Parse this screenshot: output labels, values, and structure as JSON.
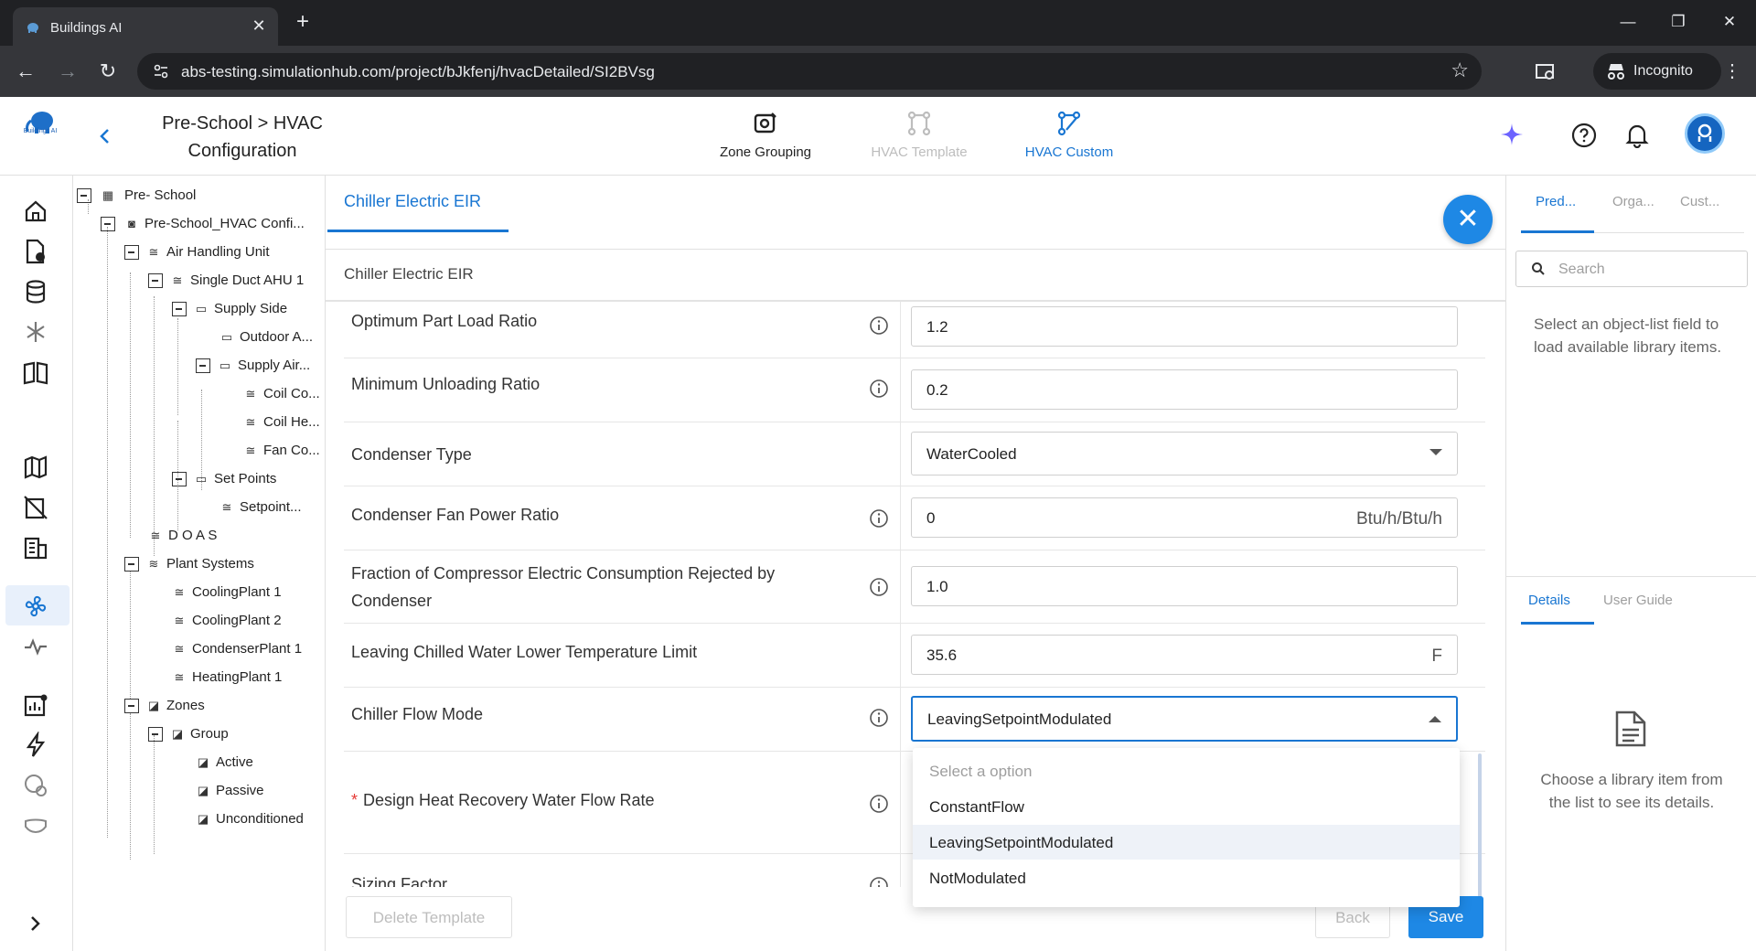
{
  "browser": {
    "tab_title": "Buildings AI",
    "url": "abs-testing.simulationhub.com/project/bJkfenj/hvacDetailed/SI2BVsg",
    "incognito_label": "Incognito"
  },
  "header": {
    "logo_text": "Buildings AI",
    "project_title": "Pre-School > HVAC Configuration",
    "tabs": [
      {
        "label": "Zone Grouping",
        "state": "default"
      },
      {
        "label": "HVAC Template",
        "state": "disabled"
      },
      {
        "label": "HVAC Custom",
        "state": "active"
      }
    ]
  },
  "tree": {
    "nodes": [
      {
        "label": "Pre- School",
        "icon": "building-icon"
      },
      {
        "label": "Pre-School_HVAC Confi...",
        "icon": "config-icon"
      },
      {
        "label": "Air Handling Unit",
        "icon": "fan-icon"
      },
      {
        "label": "Single Duct AHU 1",
        "icon": "fan-icon"
      },
      {
        "label": "Supply Side",
        "icon": "folder-icon"
      },
      {
        "label": "Outdoor A...",
        "icon": "folder-icon"
      },
      {
        "label": "Supply Air...",
        "icon": "folder-icon"
      },
      {
        "label": "Coil Co...",
        "icon": "fan-icon"
      },
      {
        "label": "Coil He...",
        "icon": "fan-icon"
      },
      {
        "label": "Fan Co...",
        "icon": "fan-icon"
      },
      {
        "label": "Set Points",
        "icon": "folder-icon"
      },
      {
        "label": "Setpoint...",
        "icon": "fan-icon"
      },
      {
        "label": "D O A S",
        "icon": "fan-icon"
      },
      {
        "label": "Plant Systems",
        "icon": "waves-icon"
      },
      {
        "label": "CoolingPlant 1",
        "icon": "fan-icon"
      },
      {
        "label": "CoolingPlant 2",
        "icon": "fan-icon"
      },
      {
        "label": "CondenserPlant 1",
        "icon": "fan-icon"
      },
      {
        "label": "HeatingPlant 1",
        "icon": "fan-icon"
      },
      {
        "label": "Zones",
        "icon": "zone-icon"
      },
      {
        "label": "Group",
        "icon": "zone-icon"
      },
      {
        "label": "Active",
        "icon": "zone-icon"
      },
      {
        "label": "Passive",
        "icon": "zone-icon"
      },
      {
        "label": "Unconditioned",
        "icon": "zone-icon"
      }
    ]
  },
  "main": {
    "tab_label": "Chiller Electric EIR",
    "section_title": "Chiller Electric EIR",
    "fields": [
      {
        "label": "Optimum Part Load Ratio",
        "value": "1.2",
        "unit": "",
        "info": true,
        "type": "text",
        "required": false
      },
      {
        "label": "Minimum Unloading Ratio",
        "value": "0.2",
        "unit": "",
        "info": true,
        "type": "text",
        "required": false
      },
      {
        "label": "Condenser Type",
        "value": "WaterCooled",
        "unit": "",
        "info": false,
        "type": "select",
        "required": false
      },
      {
        "label": "Condenser Fan Power Ratio",
        "value": "0",
        "unit": "Btu/h/Btu/h",
        "info": true,
        "type": "text",
        "required": false
      },
      {
        "label": "Fraction of Compressor Electric Consumption Rejected by Condenser",
        "value": "1.0",
        "unit": "",
        "info": true,
        "type": "text",
        "required": false
      },
      {
        "label": "Leaving Chilled Water Lower Temperature Limit",
        "value": "35.6",
        "unit": "F",
        "info": false,
        "type": "text",
        "required": false
      },
      {
        "label": "Chiller Flow Mode",
        "value": "LeavingSetpointModulated",
        "unit": "",
        "info": true,
        "type": "select-open",
        "required": false
      },
      {
        "label": "Design Heat Recovery Water Flow Rate",
        "value": "",
        "unit": "",
        "info": true,
        "type": "text",
        "required": true
      },
      {
        "label": "Sizing Factor",
        "value": "",
        "unit": "",
        "info": true,
        "type": "text",
        "required": false
      }
    ],
    "dropdown": {
      "placeholder": "Select a option",
      "options": [
        "ConstantFlow",
        "LeavingSetpointModulated",
        "NotModulated"
      ],
      "selected": "LeavingSetpointModulated"
    },
    "buttons": {
      "delete": "Delete Template",
      "back": "Back",
      "save": "Save"
    }
  },
  "right_panel": {
    "tabs": [
      "Pred...",
      "Orga...",
      "Cust..."
    ],
    "search_placeholder": "Search",
    "hint": "Select an object-list field to load available library items.",
    "detail_tabs": [
      "Details",
      "User Guide"
    ],
    "detail_hint": "Choose a library item from the list to see its details."
  },
  "colors": {
    "accent": "#1976d2",
    "save_button": "#1e88e5",
    "required": "#e53935"
  }
}
